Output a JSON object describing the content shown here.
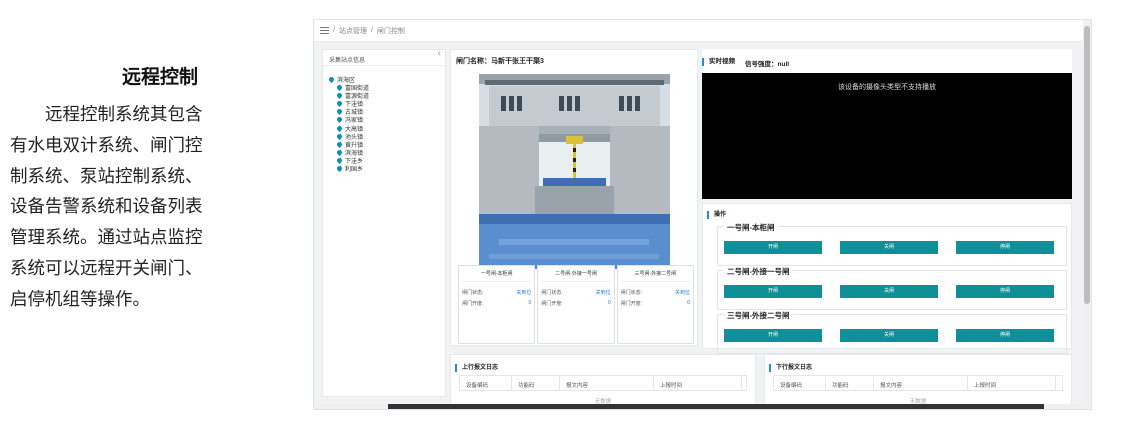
{
  "doc": {
    "title": "远程控制",
    "lines": [
      "　　远程控制系统其包含",
      "有水电双计系统、闸门控",
      "制系统、泵站控制系统、",
      "设备告警系统和设备列表",
      "管理系统。通过站点监控",
      "系统可以远程开关闸门、",
      "启停机组等操作。"
    ]
  },
  "app": {
    "breadcrumb": [
      "站点管理",
      "闸门控制"
    ],
    "breadcrumb_sep": "/",
    "tree": {
      "header": "采集站点信息",
      "root": "滨海区",
      "items": [
        "富国街道",
        "富源街道",
        "下洼镇",
        "古城镇",
        "冯家镇",
        "大高镇",
        "池头镇",
        "黄升镇",
        "滨海镇",
        "下洼乡",
        "利国乡"
      ]
    },
    "gate": {
      "name": "闸门名称：马新干张王干渠3",
      "cards": [
        {
          "title": "一号闸-本柜闸",
          "status_label": "闸门状态:",
          "status_value": "关到位",
          "open_label": "闸门开度:",
          "open_value": "0"
        },
        {
          "title": "二号闸-外接一号闸",
          "status_label": "闸门状态:",
          "status_value": "关到位",
          "open_label": "闸门开度:",
          "open_value": "0"
        },
        {
          "title": "三号闸-外接二号闸",
          "status_label": "闸门状态:",
          "status_value": "关到位",
          "open_label": "闸门开度:",
          "open_value": "0"
        }
      ]
    },
    "video": {
      "title": "实时视频",
      "signal": "信号强度：null",
      "message": "该设备的摄像头类型不支持播放"
    },
    "ops": {
      "title": "操作",
      "groups": [
        {
          "title": "一号闸-本柜闸",
          "open": "开闸",
          "close": "关闸",
          "stop": "停闸"
        },
        {
          "title": "二号闸-外接一号闸",
          "open": "开闸",
          "close": "关闸",
          "stop": "停闸"
        },
        {
          "title": "三号闸-外接二号闸",
          "open": "开闸",
          "close": "关闸",
          "stop": "停闸"
        }
      ]
    },
    "logs": {
      "up": {
        "title": "上行报文日志",
        "cols": [
          "设备编码",
          "功能码",
          "报文内容",
          "上报时间"
        ],
        "empty": "无数据"
      },
      "down": {
        "title": "下行报文日志",
        "cols": [
          "设备编码",
          "功能码",
          "报文内容",
          "上报时间"
        ],
        "empty": "无数据"
      }
    },
    "colors": {
      "accent": "#0f9098",
      "pin": "#0d8fb8",
      "video_bg": "#000000"
    }
  }
}
